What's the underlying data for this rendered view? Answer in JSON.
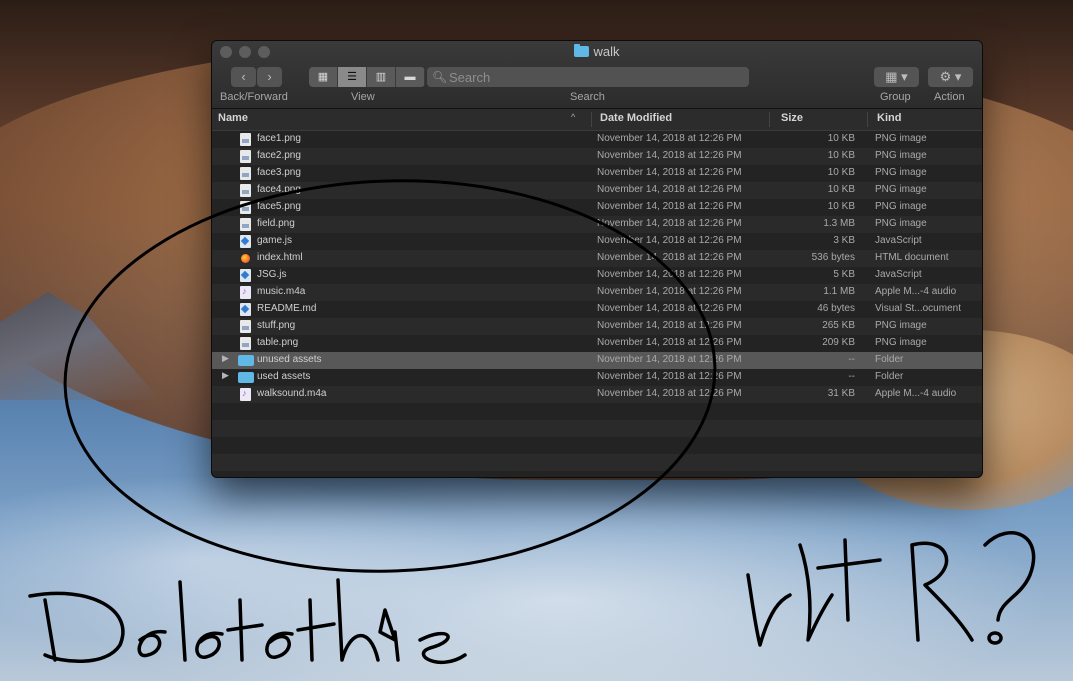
{
  "window": {
    "title": "walk",
    "toolbar": {
      "back_glyph": "‹",
      "forward_glyph": "›",
      "back_forward_label": "Back/Forward",
      "view_label": "View",
      "view_modes": [
        {
          "name": "icon-view",
          "glyph": "▦"
        },
        {
          "name": "list-view",
          "glyph": "☰"
        },
        {
          "name": "column-view",
          "glyph": "▥"
        },
        {
          "name": "gallery-view",
          "glyph": "▬"
        }
      ],
      "search_placeholder": "Search",
      "search_label": "Search",
      "group_glyph": "▦ ▾",
      "group_label": "Group",
      "action_glyph": "⚙ ▾",
      "action_label": "Action"
    },
    "columns": {
      "name": "Name",
      "date": "Date Modified",
      "size": "Size",
      "kind": "Kind",
      "sort_indicator": "^"
    },
    "files": [
      {
        "name": "face1.png",
        "date": "November 14, 2018 at 12:26 PM",
        "size": "10 KB",
        "kind": "PNG image",
        "icon": "img"
      },
      {
        "name": "face2.png",
        "date": "November 14, 2018 at 12:26 PM",
        "size": "10 KB",
        "kind": "PNG image",
        "icon": "img"
      },
      {
        "name": "face3.png",
        "date": "November 14, 2018 at 12:26 PM",
        "size": "10 KB",
        "kind": "PNG image",
        "icon": "img"
      },
      {
        "name": "face4.png",
        "date": "November 14, 2018 at 12:26 PM",
        "size": "10 KB",
        "kind": "PNG image",
        "icon": "img"
      },
      {
        "name": "face5.png",
        "date": "November 14, 2018 at 12:26 PM",
        "size": "10 KB",
        "kind": "PNG image",
        "icon": "img"
      },
      {
        "name": "field.png",
        "date": "November 14, 2018 at 12:26 PM",
        "size": "1.3 MB",
        "kind": "PNG image",
        "icon": "img"
      },
      {
        "name": "game.js",
        "date": "November 14, 2018 at 12:26 PM",
        "size": "3 KB",
        "kind": "JavaScript",
        "icon": "js"
      },
      {
        "name": "index.html",
        "date": "November 14, 2018 at 12:26 PM",
        "size": "536 bytes",
        "kind": "HTML document",
        "icon": "html"
      },
      {
        "name": "JSG.js",
        "date": "November 14, 2018 at 12:26 PM",
        "size": "5 KB",
        "kind": "JavaScript",
        "icon": "js"
      },
      {
        "name": "music.m4a",
        "date": "November 14, 2018 at 12:26 PM",
        "size": "1.1 MB",
        "kind": "Apple M...-4 audio",
        "icon": "audio"
      },
      {
        "name": "README.md",
        "date": "November 14, 2018 at 12:26 PM",
        "size": "46 bytes",
        "kind": "Visual St...ocument",
        "icon": "js"
      },
      {
        "name": "stuff.png",
        "date": "November 14, 2018 at 12:26 PM",
        "size": "265 KB",
        "kind": "PNG image",
        "icon": "img"
      },
      {
        "name": "table.png",
        "date": "November 14, 2018 at 12:26 PM",
        "size": "209 KB",
        "kind": "PNG image",
        "icon": "img"
      },
      {
        "name": "unused assets",
        "date": "November 14, 2018 at 12:26 PM",
        "size": "--",
        "kind": "Folder",
        "icon": "folder",
        "disclosure": "▶",
        "selected": true
      },
      {
        "name": "used assets",
        "date": "November 14, 2018 at 12:26 PM",
        "size": "--",
        "kind": "Folder",
        "icon": "folder",
        "disclosure": "▶"
      },
      {
        "name": "walksound.m4a",
        "date": "November 14, 2018 at 12:26 PM",
        "size": "31 KB",
        "kind": "Apple M...-4 audio",
        "icon": "audio"
      }
    ],
    "empty_rows": 4
  },
  "annotations": {
    "handwriting_left": "Deletethis",
    "handwriting_right": "WTF?",
    "stroke_color": "#000000"
  }
}
